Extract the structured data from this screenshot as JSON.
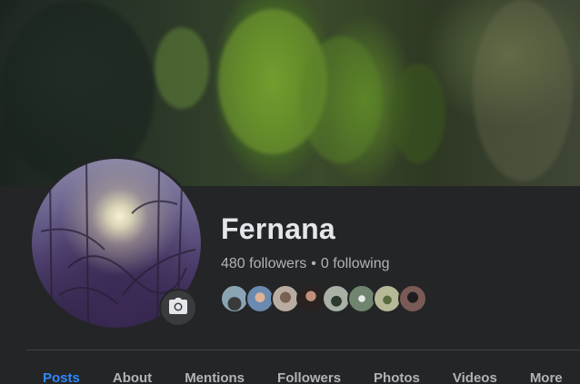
{
  "profile": {
    "name": "Fernana",
    "followers": "480 followers",
    "separator": "•",
    "following": "0 following"
  },
  "friends": [
    {
      "label": "friend-1",
      "color": "#8aa4b4"
    },
    {
      "label": "friend-2",
      "color": "#c79a82"
    },
    {
      "label": "friend-3",
      "color": "#b8ada0"
    },
    {
      "label": "friend-4",
      "color": "#2a2220"
    },
    {
      "label": "friend-5",
      "color": "#a9b0a6"
    },
    {
      "label": "friend-6",
      "color": "#6f8570"
    },
    {
      "label": "friend-7",
      "color": "#b7b996"
    },
    {
      "label": "friend-8",
      "color": "#7a5a55"
    }
  ],
  "tabs": [
    {
      "label": "Posts",
      "active": true
    },
    {
      "label": "About",
      "active": false
    },
    {
      "label": "Mentions",
      "active": false
    },
    {
      "label": "Followers",
      "active": false
    },
    {
      "label": "Photos",
      "active": false
    },
    {
      "label": "Videos",
      "active": false
    },
    {
      "label": "More",
      "active": false
    }
  ],
  "icons": {
    "camera": "camera-icon"
  },
  "colors": {
    "background": "#242526",
    "text_primary": "#e4e6eb",
    "text_secondary": "#b0b3b8",
    "accent": "#2d88ff"
  }
}
